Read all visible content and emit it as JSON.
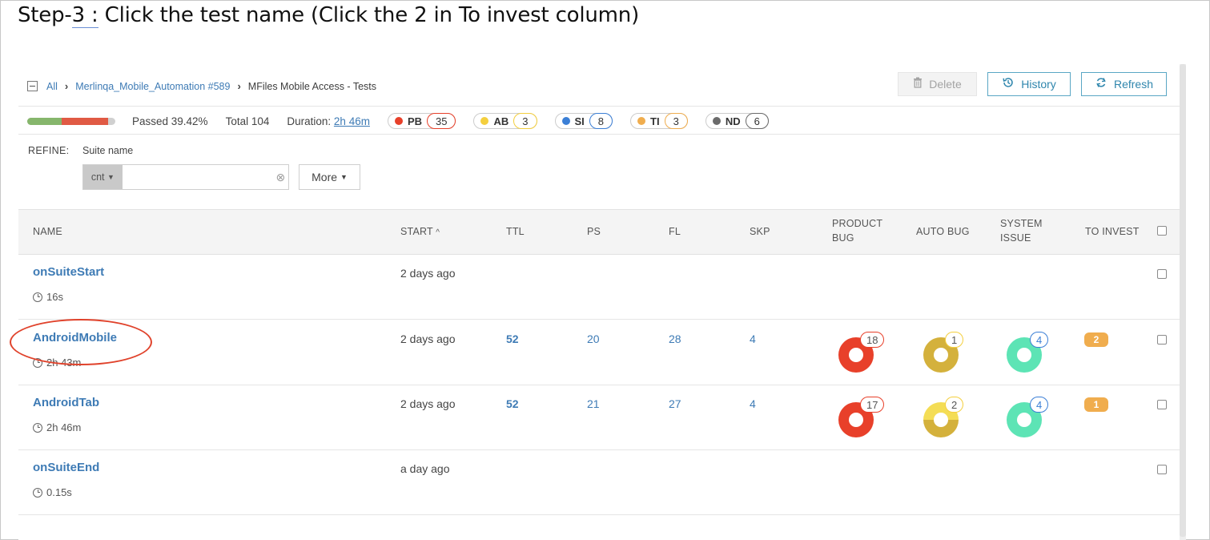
{
  "step_title": {
    "prefix": "Step-",
    "underlined": "3 :",
    "rest": " Click the test name (Click the 2 in To invest column)"
  },
  "breadcrumb": {
    "all": "All",
    "launch": "Merlinqa_Mobile_Automation #589",
    "current": "MFiles Mobile Access - Tests"
  },
  "toolbar": {
    "delete": "Delete",
    "history": "History",
    "refresh": "Refresh"
  },
  "stats": {
    "passed": "Passed 39.42%",
    "total": "Total 104",
    "duration_label": "Duration:",
    "duration_value": "2h 46m",
    "pass_fraction": 0.3942,
    "defects": [
      {
        "code": "PB",
        "count": "35",
        "color": "#e8402a"
      },
      {
        "code": "AB",
        "count": "3",
        "color": "#f4cf3e"
      },
      {
        "code": "SI",
        "count": "8",
        "color": "#3b7fd6"
      },
      {
        "code": "TI",
        "count": "3",
        "color": "#f0ad4e"
      },
      {
        "code": "ND",
        "count": "6",
        "color": "#6b6b6b"
      }
    ]
  },
  "refine": {
    "label": "REFINE:",
    "field": "Suite name",
    "condition": "cnt",
    "value": "",
    "more": "More"
  },
  "table": {
    "headers": {
      "name": "NAME",
      "start": "START",
      "ttl": "TTL",
      "ps": "PS",
      "fl": "FL",
      "skp": "SKP",
      "product_bug_1": "PRODUCT",
      "product_bug_2": "BUG",
      "auto_bug": "AUTO BUG",
      "system_issue_1": "SYSTEM",
      "system_issue_2": "ISSUE",
      "to_invest": "TO INVEST"
    },
    "rows": [
      {
        "name": "onSuiteStart",
        "duration": "16s",
        "start": "2 days ago"
      },
      {
        "name": "AndroidMobile",
        "duration": "2h 43m",
        "start": "2 days ago",
        "ttl": "52",
        "ps": "20",
        "fl": "28",
        "skp": "4",
        "product_bug": "18",
        "auto_bug": "1",
        "system_issue": "4",
        "to_invest": "2"
      },
      {
        "name": "AndroidTab",
        "duration": "2h 46m",
        "start": "2 days ago",
        "ttl": "52",
        "ps": "21",
        "fl": "27",
        "skp": "4",
        "product_bug": "17",
        "auto_bug": "2",
        "system_issue": "4",
        "to_invest": "1"
      },
      {
        "name": "onSuiteEnd",
        "duration": "0.15s",
        "start": "a day ago"
      }
    ]
  },
  "colors": {
    "product_bug": "#e8402a",
    "auto_bug_dark": "#d4b13c",
    "auto_bug_light": "#f4dd55",
    "system_issue": "#5de4b5",
    "to_invest": "#f0ad4e",
    "annotation": "#e0422b"
  }
}
